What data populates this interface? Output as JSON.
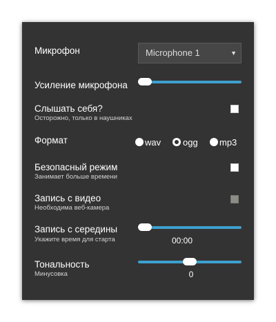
{
  "settings": {
    "microphone": {
      "label": "Микрофон",
      "selected": "Microphone 1"
    },
    "gain": {
      "label": "Усиление микрофона",
      "level": 0.0
    },
    "monitor": {
      "label": "Слышать себя?",
      "hint": "Осторожно, только в наушниках",
      "checked": false
    },
    "format": {
      "label": "Формат",
      "options": [
        "wav",
        "ogg",
        "mp3"
      ],
      "selected": "ogg"
    },
    "safe_mode": {
      "label": "Безопасный режим",
      "hint": "Занимает больше времени",
      "checked": false
    },
    "video": {
      "label": "Запись с видео",
      "hint": "Необходима веб-камера",
      "checked": false,
      "disabled": true
    },
    "start_offset": {
      "label": "Запись с середины",
      "hint": "Укажите время для старта",
      "value": "00:00",
      "level": 0.0
    },
    "pitch": {
      "label": "Тональность",
      "hint": "Минусовка",
      "value": "0",
      "level": 0.5
    }
  },
  "colors": {
    "panel": "#333333",
    "accent": "#3da1cf",
    "text": "#ffffff",
    "hint": "#d2d2d2"
  },
  "icons": {
    "select_arrow": "▼"
  }
}
